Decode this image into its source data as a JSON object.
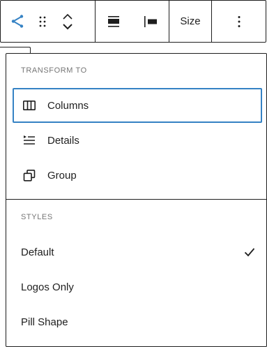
{
  "toolbar": {
    "size_label": "Size",
    "accent": "#3582c4"
  },
  "transform": {
    "title": "TRANSFORM TO",
    "items": [
      {
        "label": "Columns",
        "icon": "columns-icon"
      },
      {
        "label": "Details",
        "icon": "details-icon"
      },
      {
        "label": "Group",
        "icon": "group-icon"
      }
    ]
  },
  "styles": {
    "title": "STYLES",
    "items": [
      {
        "label": "Default",
        "selected": true
      },
      {
        "label": "Logos Only",
        "selected": false
      },
      {
        "label": "Pill Shape",
        "selected": false
      }
    ]
  }
}
